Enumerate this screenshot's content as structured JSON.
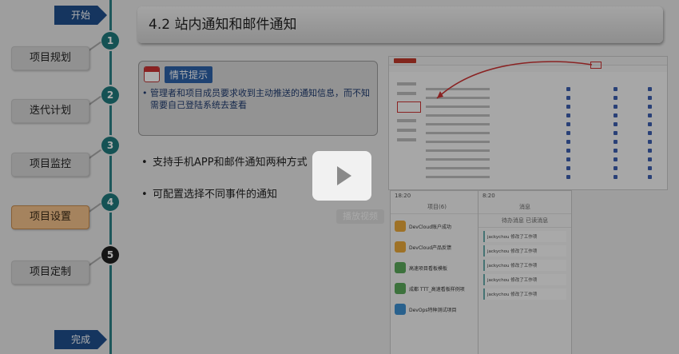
{
  "nav": {
    "start_label": "开始",
    "end_label": "完成",
    "steps": [
      {
        "number": "1",
        "label": "项目规划"
      },
      {
        "number": "2",
        "label": "迭代计划"
      },
      {
        "number": "3",
        "label": "项目监控"
      },
      {
        "number": "4",
        "label": "项目设置"
      },
      {
        "number": "5",
        "label": "项目定制"
      }
    ],
    "active_step": "4"
  },
  "slide": {
    "title": "4.2 站内通知和邮件通知",
    "tip_label": "情节提示",
    "tip_text": "管理者和项目成员要求收到主动推送的通知信息，而不知需要自己登陆系统去查看",
    "bullets": [
      "支持手机APP和邮件通知两种方式",
      "可配置选择不同事件的通知"
    ],
    "playback_label": "播放视频"
  },
  "phone1": {
    "status_time": "18:20",
    "header": "项目(6)",
    "apps": [
      {
        "name": "DevCloud账户成功",
        "color": "#e9a93a"
      },
      {
        "name": "DevCloud产品反馈",
        "color": "#e9a93a"
      },
      {
        "name": "高速项目看板模板",
        "color": "#5aa85a"
      },
      {
        "name": "成都 TTT_高速看板样例项",
        "color": "#5aa85a"
      },
      {
        "name": "DevOps特种测试项目",
        "color": "#3d8fd0"
      }
    ]
  },
  "phone2": {
    "status_time": "8:20",
    "header": "消息",
    "tabs": "待办消息    已读消息",
    "messages": [
      "jackychou 修改了工作项",
      "jackychou 修改了工作项",
      "jackychou 修改了工作项",
      "jackychou 修改了工作项",
      "jackychou 修改了工作项"
    ]
  },
  "colors": {
    "timeline": "#2d8086",
    "flag": "#1f4f8c",
    "active_step": "#f3c18b",
    "tip_label": "#2d62a8"
  }
}
